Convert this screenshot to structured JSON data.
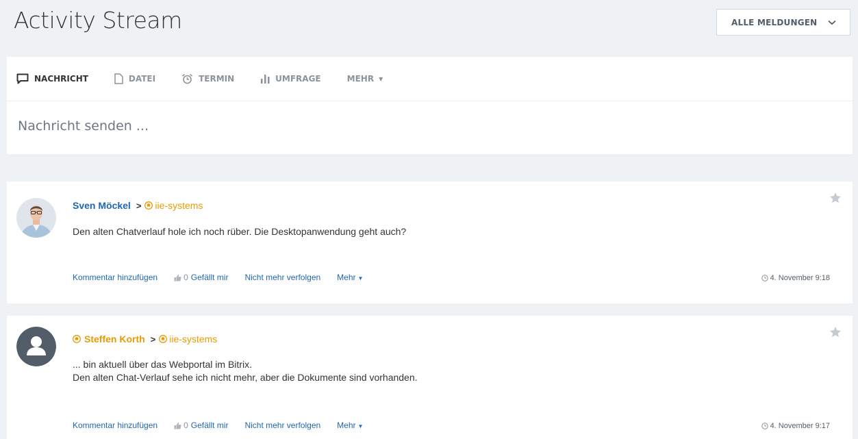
{
  "header": {
    "title": "Activity Stream",
    "filter_label": "ALLE MELDUNGEN"
  },
  "composer": {
    "tabs": [
      {
        "label": "NACHRICHT",
        "icon": "message-icon"
      },
      {
        "label": "DATEI",
        "icon": "file-icon"
      },
      {
        "label": "TERMIN",
        "icon": "alarm-icon"
      },
      {
        "label": "UMFRAGE",
        "icon": "poll-icon"
      },
      {
        "label": "MEHR",
        "icon": "caret-down-icon"
      }
    ],
    "placeholder": "Nachricht senden ..."
  },
  "posts": [
    {
      "author": "Sven Möckel",
      "group": "iie-systems",
      "text_lines": [
        "Den alten Chatverlauf hole ich noch rüber. Die Desktopanwendung geht auch?"
      ],
      "actions": {
        "comment": "Kommentar hinzufügen",
        "like_count": "0",
        "like_label": "Gefällt mir",
        "unfollow": "Nicht mehr verfolgen",
        "more": "Mehr"
      },
      "time": "4. November 9:18"
    },
    {
      "author": "Steffen Korth",
      "group": "iie-systems",
      "text_lines": [
        "... bin aktuell über das Webportal im Bitrix.",
        "Den alten Chat-Verlauf sehe ich nicht mehr, aber die Dokumente sind vorhanden."
      ],
      "actions": {
        "comment": "Kommentar hinzufügen",
        "like_count": "0",
        "like_label": "Gefällt mir",
        "unfollow": "Nicht mehr verfolgen",
        "more": "Mehr"
      },
      "time": "4. November 9:17"
    }
  ],
  "colors": {
    "link": "#2067b0",
    "extranet": "#e89b06",
    "background": "#eef2f4"
  }
}
